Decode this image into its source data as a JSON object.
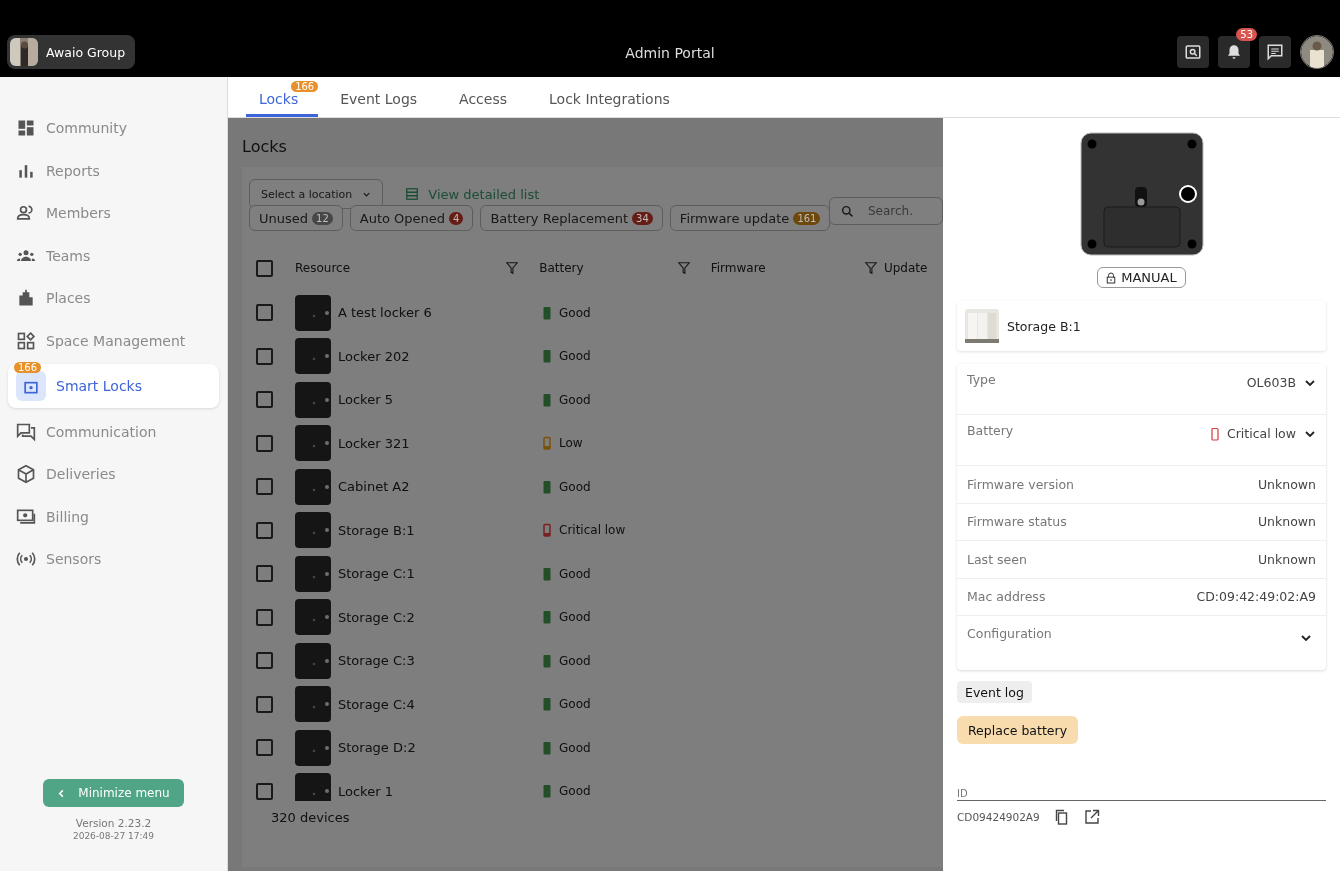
{
  "topbar": {
    "org": "Awaio Group",
    "title": "Admin Portal",
    "notifications": "53"
  },
  "sidebar": {
    "items": [
      {
        "label": "Community",
        "selected": false
      },
      {
        "label": "Reports",
        "selected": false
      },
      {
        "label": "Members",
        "selected": false
      },
      {
        "label": "Teams",
        "selected": false
      },
      {
        "label": "Places",
        "selected": false
      },
      {
        "label": "Space Management",
        "selected": false
      },
      {
        "label": "Smart Locks",
        "selected": true,
        "badge": "166"
      },
      {
        "label": "Communication",
        "selected": false
      },
      {
        "label": "Deliveries",
        "selected": false
      },
      {
        "label": "Billing",
        "selected": false
      },
      {
        "label": "Sensors",
        "selected": false
      }
    ],
    "minimize": "Minimize menu",
    "version": "Version 2.23.2",
    "date": "2026-08-27 17:49"
  },
  "tabs": [
    {
      "label": "Locks",
      "selected": true,
      "badge": "166"
    },
    {
      "label": "Event Logs",
      "selected": false
    },
    {
      "label": "Access",
      "selected": false
    },
    {
      "label": "Lock Integrations",
      "selected": false
    }
  ],
  "page": {
    "title": "Locks",
    "location_select": "Select a location",
    "detailed_link": "View detailed list",
    "search": {
      "placeholder": "Search."
    },
    "filters": [
      {
        "label": "Unused",
        "count": "12",
        "color": "#474747"
      },
      {
        "label": "Auto Opened",
        "count": "4",
        "color": "#661d16"
      },
      {
        "label": "Battery Replacement",
        "count": "34",
        "color": "#661d16"
      },
      {
        "label": "Firmware update",
        "count": "161",
        "color": "#6e470a"
      }
    ],
    "select_all": {
      "checked": false
    },
    "columns": [
      "Resource",
      "Battery",
      "Firmware",
      "Update"
    ],
    "rows": [
      {
        "name": "A test locker 6",
        "battery": "Good",
        "checked": false,
        "kind": "full",
        "color": "#224f27"
      },
      {
        "name": "Locker 202",
        "battery": "Good",
        "checked": false,
        "kind": "full",
        "color": "#224f27"
      },
      {
        "name": "Locker 5",
        "battery": "Good",
        "checked": false,
        "kind": "full",
        "color": "#224f27"
      },
      {
        "name": "Locker 321",
        "battery": "Low",
        "checked": false,
        "kind": "empty",
        "color": "#7a5209"
      },
      {
        "name": "Cabinet A2",
        "battery": "Good",
        "checked": false,
        "kind": "full",
        "color": "#224f27"
      },
      {
        "name": "Storage B:1",
        "battery": "Critical low",
        "checked": false,
        "kind": "empty",
        "color": "#7a2020"
      },
      {
        "name": "Storage C:1",
        "battery": "Good",
        "checked": false,
        "kind": "full",
        "color": "#224f27"
      },
      {
        "name": "Storage C:2",
        "battery": "Good",
        "checked": false,
        "kind": "full",
        "color": "#224f27"
      },
      {
        "name": "Storage C:3",
        "battery": "Good",
        "checked": false,
        "kind": "full",
        "color": "#224f27"
      },
      {
        "name": "Storage C:4",
        "battery": "Good",
        "checked": false,
        "kind": "full",
        "color": "#224f27"
      },
      {
        "name": "Storage D:2",
        "battery": "Good",
        "checked": false,
        "kind": "full",
        "color": "#224f27"
      },
      {
        "name": "Locker 1",
        "battery": "Good",
        "checked": false,
        "kind": "full",
        "color": "#224f27"
      }
    ],
    "count": "320 devices"
  },
  "drawer": {
    "mode": "MANUAL",
    "resource": "Storage B:1",
    "fields": [
      {
        "label": "Type",
        "value": "OL603B",
        "kind": "select"
      },
      {
        "label": "Battery",
        "value": "Critical low",
        "kind": "battery"
      },
      {
        "label": "Firmware version",
        "value": "Unknown",
        "kind": "text"
      },
      {
        "label": "Firmware status",
        "value": "Unknown",
        "kind": "text"
      },
      {
        "label": "Last seen",
        "value": "Unknown",
        "kind": "text"
      },
      {
        "label": "Mac address",
        "value": "CD:09:42:49:02:A9",
        "kind": "text"
      },
      {
        "label": "Configuration",
        "kind": "expand"
      }
    ],
    "event_log": "Event log",
    "replace_battery": "Replace battery",
    "id_label": "ID",
    "id_value": "CD09424902A9"
  }
}
